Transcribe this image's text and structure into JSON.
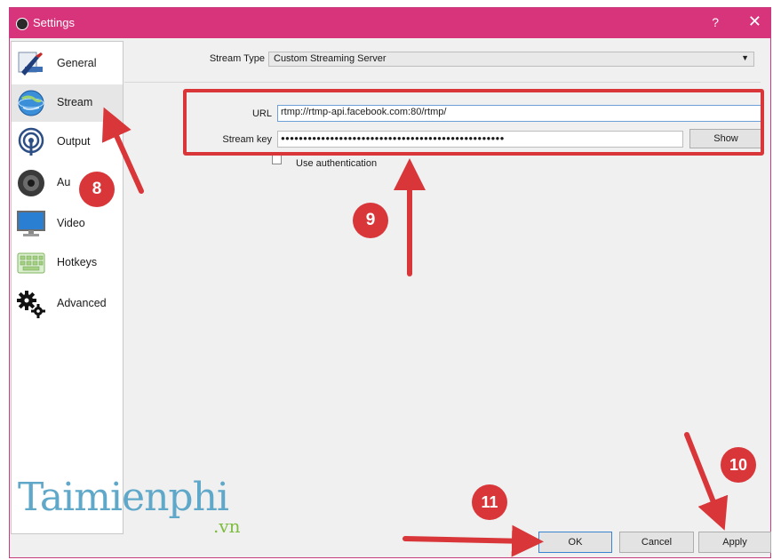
{
  "window": {
    "title": "Settings",
    "help_glyph": "?",
    "close_glyph": "✕"
  },
  "sidebar": {
    "items": [
      {
        "label": "General",
        "icon": "general-icon"
      },
      {
        "label": "Stream",
        "icon": "stream-globe-icon",
        "active": true
      },
      {
        "label": "Output",
        "icon": "output-icon"
      },
      {
        "label": "Au",
        "icon": "audio-speaker-icon"
      },
      {
        "label": "Video",
        "icon": "video-monitor-icon"
      },
      {
        "label": "Hotkeys",
        "icon": "hotkeys-keyboard-icon"
      },
      {
        "label": "Advanced",
        "icon": "advanced-gears-icon"
      }
    ]
  },
  "stream": {
    "type_label": "Stream Type",
    "type_value": "Custom Streaming Server",
    "url_label": "URL",
    "url_value": "rtmp://rtmp-api.facebook.com:80/rtmp/",
    "key_label": "Stream key",
    "key_value": "●●●●●●●●●●●●●●●●●●●●●●●●●●●●●●●●●●●●●●●●●●●●●●●●●●",
    "show_label": "Show",
    "auth_label": "Use authentication"
  },
  "buttons": {
    "ok": "OK",
    "cancel": "Cancel",
    "apply": "Apply"
  },
  "annotations": {
    "step8": "8",
    "step9": "9",
    "step10": "10",
    "step11": "11"
  },
  "watermark": {
    "brand": "Taimienphi",
    "tld": ".vn"
  },
  "colors": {
    "title_bar": "#d7347c",
    "annotation_red": "#d9363a",
    "logo_blue": "#5fa8c9",
    "logo_green": "#7dbd3e"
  }
}
